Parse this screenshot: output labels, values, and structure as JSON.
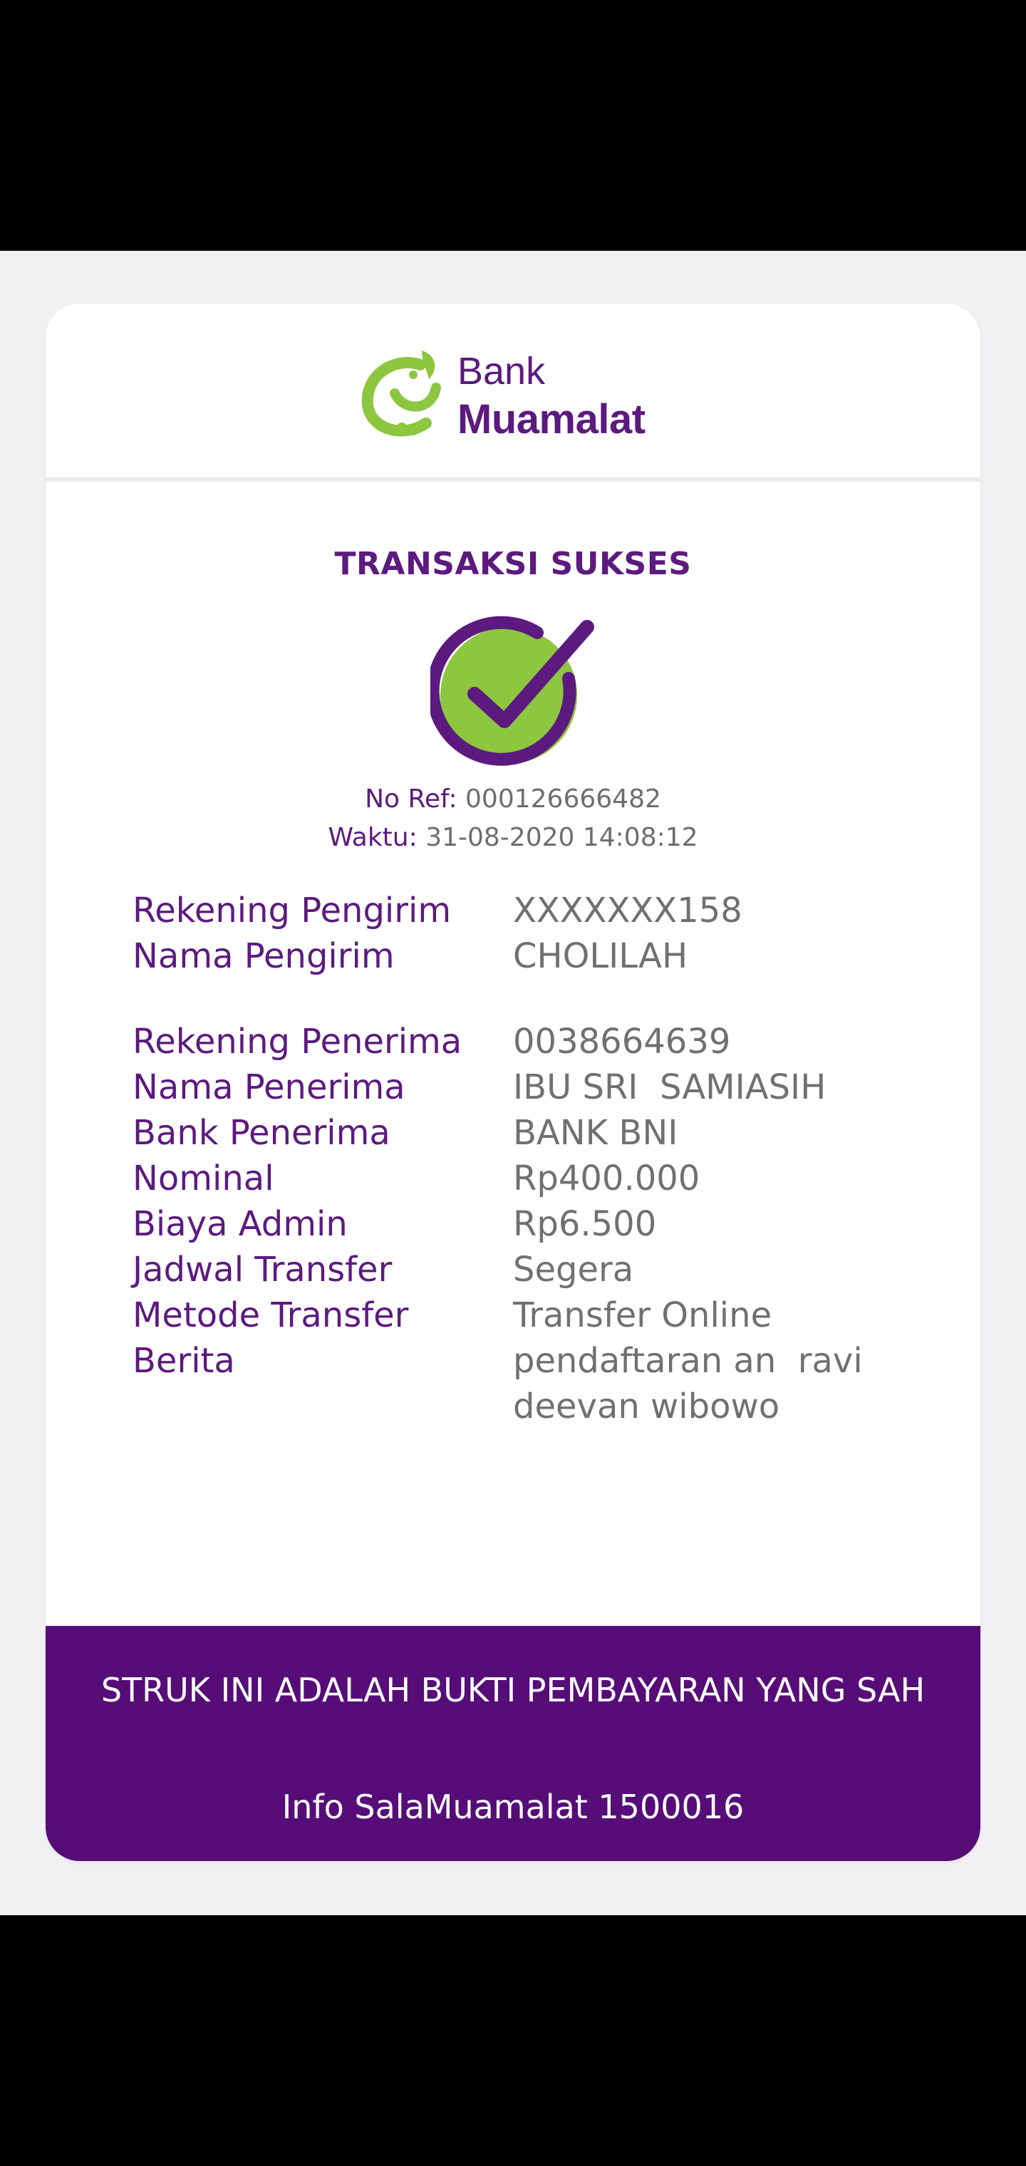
{
  "brand": {
    "line1": "Bank",
    "line2": "Muamalat",
    "logo_icon": "bank-muamalat-logo",
    "primary_color": "#5c1a7f",
    "accent_color": "#8dc63f"
  },
  "status": {
    "title": "TRANSAKSI SUKSES",
    "icon": "check-circle-icon"
  },
  "reference": {
    "no_ref_label": "No Ref:",
    "no_ref_value": "000126666482",
    "time_label": "Waktu:",
    "time_value": "31-08-2020 14:08:12"
  },
  "sender": [
    {
      "label": "Rekening Pengirim",
      "value": "XXXXXXX158"
    },
    {
      "label": "Nama Pengirim",
      "value": "CHOLILAH"
    }
  ],
  "details": [
    {
      "label": "Rekening Penerima",
      "value": "0038664639"
    },
    {
      "label": "Nama Penerima",
      "value": "IBU SRI  SAMIASIH"
    },
    {
      "label": "Bank Penerima",
      "value": "BANK BNI"
    },
    {
      "label": "Nominal",
      "value": "Rp400.000"
    },
    {
      "label": "Biaya Admin",
      "value": "Rp6.500"
    },
    {
      "label": "Jadwal Transfer",
      "value": "Segera"
    },
    {
      "label": "Metode Transfer",
      "value": "Transfer Online"
    },
    {
      "label": "Berita",
      "value": "pendaftaran an  ravi\ndeevan wibowo"
    }
  ],
  "footer": {
    "note": "STRUK INI ADALAH BUKTI PEMBAYARAN YANG SAH",
    "info": "Info SalaMuamalat 1500016",
    "background": "#560d78"
  }
}
